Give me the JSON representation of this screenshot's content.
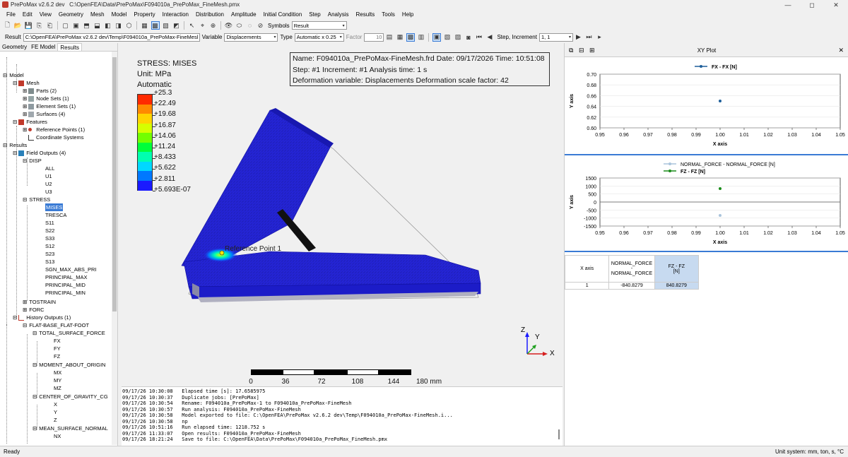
{
  "window": {
    "app_title": "PrePoMax v2.6.2 dev",
    "file_path": "C:\\OpenFEA\\Data\\PrePoMax\\F094010a_PrePoMax_FineMesh.pmx",
    "controls": {
      "minimize": "—",
      "maximize": "◻",
      "close": "✕"
    }
  },
  "menu": [
    "File",
    "Edit",
    "View",
    "Geometry",
    "Mesh",
    "Model",
    "Property",
    "Interaction",
    "Distribution",
    "Amplitude",
    "Initial Condition",
    "Step",
    "Analysis",
    "Results",
    "Tools",
    "Help"
  ],
  "toolbar1": {
    "symbols_label": "Symbols",
    "symbols_value": "Result"
  },
  "toolbar2": {
    "result_label": "Result",
    "result_value": "C:\\OpenFEA\\PrePoMax v2.6.2 dev\\Temp\\F094010a_PrePoMax-FineMesl",
    "variable_label": "Variable",
    "variable_value": "Displacements",
    "type_label": "Type",
    "type_value": "Automatic x 0.25",
    "factor_label": "Factor",
    "factor_value": "10",
    "step_label": "Step, Increment",
    "step_value": "1, 1"
  },
  "left_tabs": [
    "Geometry",
    "FE Model",
    "Results"
  ],
  "tree": {
    "model": "Model",
    "mesh": "Mesh",
    "parts": "Parts (2)",
    "node_sets": "Node Sets (1)",
    "element_sets": "Element Sets (1)",
    "surfaces": "Surfaces (4)",
    "features": "Features",
    "reference_points": "Reference Points (1)",
    "coordinate_systems": "Coordinate Systems",
    "results": "Results",
    "field_outputs": "Field Outputs (4)",
    "disp": "DISP",
    "disp_items": [
      "ALL",
      "U1",
      "U2",
      "U3"
    ],
    "stress": "STRESS",
    "stress_items": [
      "MISES",
      "TRESCA",
      "S11",
      "S22",
      "S33",
      "S12",
      "S23",
      "S13",
      "SGN_MAX_ABS_PRI",
      "PRINCIPAL_MAX",
      "PRINCIPAL_MID",
      "PRINCIPAL_MIN"
    ],
    "tostrain": "TOSTRAIN",
    "forc": "FORC",
    "history_outputs": "History Outputs (1)",
    "flat_base": "FLAT-BASE_FLAT-FOOT",
    "total_surface_force": "TOTAL_SURFACE_FORCE",
    "tsf_items": [
      "FX",
      "FY",
      "FZ"
    ],
    "moment": "MOMENT_ABOUT_ORIGIN",
    "moment_items": [
      "MX",
      "MY",
      "MZ"
    ],
    "cog": "CENTER_OF_GRAVITY_CG",
    "cog_items": [
      "X",
      "Y",
      "Z"
    ],
    "msn": "MEAN_SURFACE_NORMAL",
    "msn_items": [
      "NX"
    ]
  },
  "legend": {
    "title1": "STRESS: MISES",
    "title2": "Unit: MPa",
    "title3": "Automatic",
    "ticks": [
      "+25.3",
      "+22.49",
      "+19.68",
      "+16.87",
      "+14.06",
      "+11.24",
      "+8.433",
      "+5.622",
      "+2.811",
      "+5.693E-07"
    ],
    "colors": [
      "#ff2a00",
      "#ff8a00",
      "#ffd400",
      "#d6ff00",
      "#73ff00",
      "#00ff3a",
      "#00ffb0",
      "#00d8ff",
      "#0078ff",
      "#1a1aff"
    ]
  },
  "info": {
    "line1": "Name: F094010a_PrePoMax-FineMesh.frd   Date: 09/17/2026   Time: 10:51:08",
    "line2": "Step: #1   Increment: #1   Analysis time: 1 s",
    "line3": "Deformation variable: Displacements   Deformation scale factor: 42"
  },
  "viewport": {
    "reference_point_label": "Reference Point 1",
    "triad": {
      "z": "Z",
      "y": "Y",
      "x": "X"
    },
    "scale_labels": [
      "0",
      "36",
      "72",
      "108",
      "144",
      "180 mm"
    ]
  },
  "console": [
    "09/17/26 10:30:08   Elapsed time [s]: 17.6585975",
    "09/17/26 10:30:37   Duplicate jobs: [PrePoMax]",
    "09/17/26 10:30:54   Rename: F094010a_PrePoMax-1 to F094010a_PrePoMax-FineMesh",
    "09/17/26 10:30:57   Run analysis: F094010a_PrePoMax-FineMesh",
    "09/17/26 10:30:58   Model exported to file: C:\\OpenFEA\\PrePoMax v2.6.2 dev\\Temp\\F094010a_PrePoMax-FineMesh.i...",
    "09/17/26 10:30:58   np",
    "09/17/26 10:51:16   Run elapsed time: 1218.752 s",
    "09/17/26 11:33:07   Open results: F094010a_PrePoMax-FineMesh",
    "09/17/26 18:21:24   Save to file: C:\\OpenFEA\\Data\\PrePoMax\\F094010a_PrePoMax_FineMesh.pmx"
  ],
  "xy_panel": {
    "title": "XY Plot",
    "close": "✕"
  },
  "plot1": {
    "legend": "FX - FX [N]",
    "xlabel": "X axis",
    "ylabel": "Y axis",
    "yticks": [
      "0.70",
      "0.68",
      "0.66",
      "0.64",
      "0.62",
      "0.60"
    ],
    "xticks": [
      "0.95",
      "0.96",
      "0.97",
      "0.98",
      "0.99",
      "1.00",
      "1.01",
      "1.02",
      "1.03",
      "1.04",
      "1.05"
    ]
  },
  "plot2": {
    "legend1": "NORMAL_FORCE - NORMAL_FORCE [N]",
    "legend2": "FZ - FZ [N]",
    "xlabel": "X axis",
    "ylabel": "Y axis",
    "yticks": [
      "1500",
      "1000",
      "500",
      "0",
      "-500",
      "-1000",
      "-1500"
    ],
    "xticks": [
      "0.95",
      "0.96",
      "0.97",
      "0.98",
      "0.99",
      "1.00",
      "1.01",
      "1.02",
      "1.03",
      "1.04",
      "1.05"
    ]
  },
  "chart_data": [
    {
      "type": "scatter",
      "series": [
        {
          "name": "FX - FX [N]",
          "x": [
            1.0
          ],
          "y": [
            0.65
          ]
        }
      ],
      "xlabel": "X axis",
      "ylabel": "Y axis",
      "xlim": [
        0.95,
        1.05
      ],
      "ylim": [
        0.6,
        0.7
      ]
    },
    {
      "type": "scatter",
      "series": [
        {
          "name": "NORMAL_FORCE - NORMAL_FORCE [N]",
          "x": [
            1.0
          ],
          "y": [
            -840.8279
          ]
        },
        {
          "name": "FZ - FZ [N]",
          "x": [
            1.0
          ],
          "y": [
            840.8279
          ]
        }
      ],
      "xlabel": "X axis",
      "ylabel": "Y axis",
      "xlim": [
        0.95,
        1.05
      ],
      "ylim": [
        -1500,
        1500
      ]
    }
  ],
  "table": {
    "h_x": "X axis",
    "h_nf": "NORMAL_FORCE\n-\nNORMAL_FORCE",
    "h_fz": "FZ - FZ\n[N]",
    "row_x": "1",
    "row_nf": "-840.8279",
    "row_fz": "840.8279"
  },
  "status": {
    "left": "Ready",
    "right": "Unit system: mm, ton, s, °C"
  }
}
